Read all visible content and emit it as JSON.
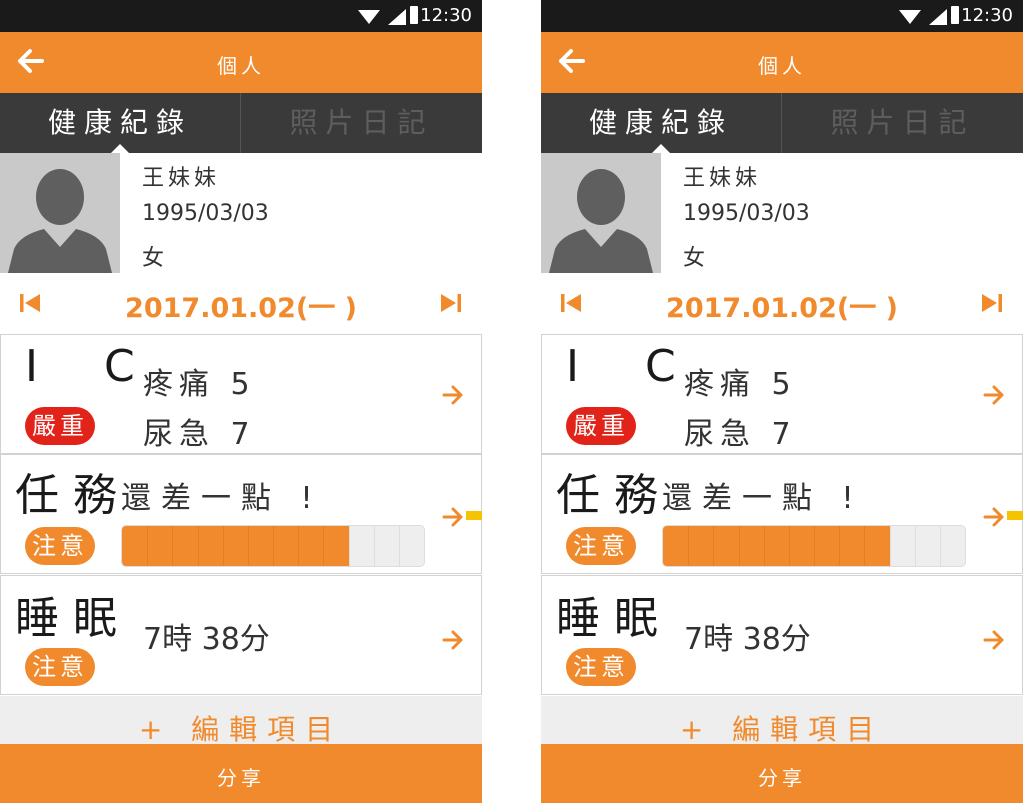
{
  "status_bar": {
    "time": "12:30"
  },
  "app_bar": {
    "title": "個人"
  },
  "tabs": [
    {
      "label": "健康紀錄",
      "active": true
    },
    {
      "label": "照片日記",
      "active": false
    }
  ],
  "profile": {
    "name": "王妹妹",
    "birthdate": "1995/03/03",
    "gender": "女"
  },
  "date_nav": {
    "date": "2017.01.02(一 )"
  },
  "cards": {
    "ic": {
      "title": "I C",
      "badge": "嚴重",
      "lines": [
        "疼痛 5",
        "尿急 7"
      ]
    },
    "task": {
      "title": "任 務",
      "message": "還差一點 !",
      "badge": "注意",
      "progress_fraction": 0.75,
      "progress_segments": 12
    },
    "sleep": {
      "title": "睡 眠",
      "value": "7時 38分",
      "badge": "注意"
    }
  },
  "edit_items_label": "+ 編輯項目",
  "share_label": "分享",
  "colors": {
    "accent": "#f08a2c",
    "danger": "#e2231a",
    "tab_bar": "#3a3a3a",
    "status_bar": "#1a1a1a"
  },
  "icons": {
    "back": "arrow-left-icon",
    "prev": "skip-previous-icon",
    "next": "skip-next-icon",
    "go": "arrow-right-icon"
  }
}
